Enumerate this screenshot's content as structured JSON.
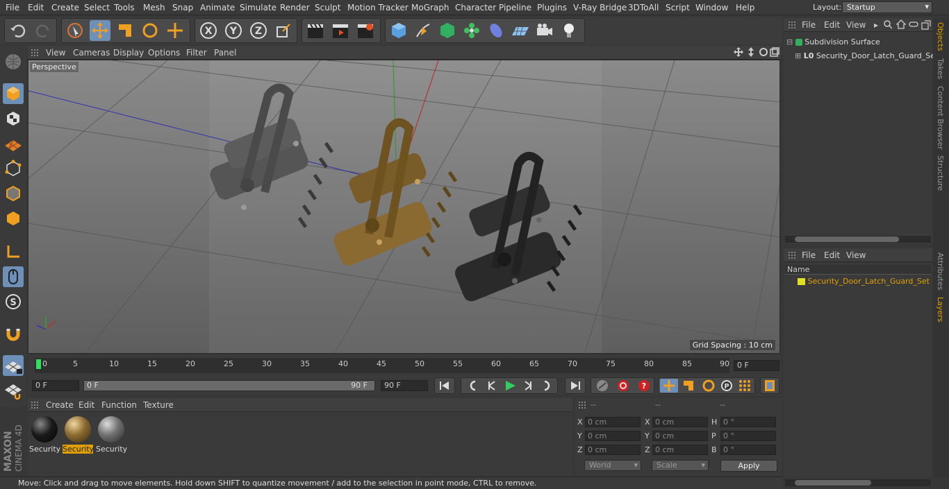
{
  "menu": [
    "File",
    "Edit",
    "Create",
    "Select",
    "Tools",
    "Mesh",
    "Snap",
    "Animate",
    "Simulate",
    "Render",
    "Sculpt",
    "Motion Tracker",
    "MoGraph",
    "Character",
    "Pipeline",
    "Plugins",
    "V-Ray Bridge",
    "3DToAll",
    "Script",
    "Window",
    "Help"
  ],
  "layout": {
    "label": "Layout:",
    "value": "Startup"
  },
  "viewport": {
    "menu": [
      "View",
      "Cameras",
      "Display",
      "Options",
      "Filter",
      "Panel"
    ],
    "label": "Perspective",
    "grid_spacing": "Grid Spacing : 10 cm"
  },
  "timeline": {
    "ticks": [
      "0",
      "5",
      "10",
      "15",
      "20",
      "25",
      "30",
      "35",
      "40",
      "45",
      "50",
      "55",
      "60",
      "65",
      "70",
      "75",
      "80",
      "85",
      "90"
    ],
    "current": "0 F",
    "start": "0 F",
    "range_start": "0 F",
    "range_end": "90 F",
    "end": "90 F"
  },
  "material_menu": [
    "Create",
    "Edit",
    "Function",
    "Texture"
  ],
  "materials": [
    {
      "label": "Security",
      "color": "#1a1a1a",
      "selected": false
    },
    {
      "label": "Security",
      "color": "#8a6a30",
      "selected": true
    },
    {
      "label": "Security",
      "color": "#707070",
      "selected": false
    }
  ],
  "coords": {
    "headers": [
      "--",
      "--",
      "--"
    ],
    "rows": [
      {
        "a": "X",
        "v1": "0 cm",
        "b": "X",
        "v2": "0 cm",
        "c": "H",
        "v3": "0 °"
      },
      {
        "a": "Y",
        "v1": "0 cm",
        "b": "Y",
        "v2": "0 cm",
        "c": "P",
        "v3": "0 °"
      },
      {
        "a": "Z",
        "v1": "0 cm",
        "b": "Z",
        "v2": "0 cm",
        "c": "B",
        "v3": "0 °"
      }
    ],
    "mode1": "World",
    "mode2": "Scale",
    "apply": "Apply"
  },
  "status": "Move: Click and drag to move elements. Hold down SHIFT to quantize movement / add to the selection in point mode, CTRL to remove.",
  "objects": {
    "menu": [
      "File",
      "Edit",
      "View"
    ],
    "items": [
      "Subdivision Surface",
      "Security_Door_Latch_Guard_Set"
    ]
  },
  "layers": {
    "menu": [
      "File",
      "Edit",
      "View"
    ],
    "column": "Name",
    "items": [
      "Security_Door_Latch_Guard_Set"
    ]
  },
  "side_tabs": [
    "Objects",
    "Takes",
    "Content Browser",
    "Structure",
    "Attributes",
    "Layers"
  ],
  "brand": {
    "maxon": "MAXON",
    "product": "CINEMA 4D"
  },
  "colors": {
    "accent": "#e0a000",
    "selection": "#6d8fb8"
  }
}
